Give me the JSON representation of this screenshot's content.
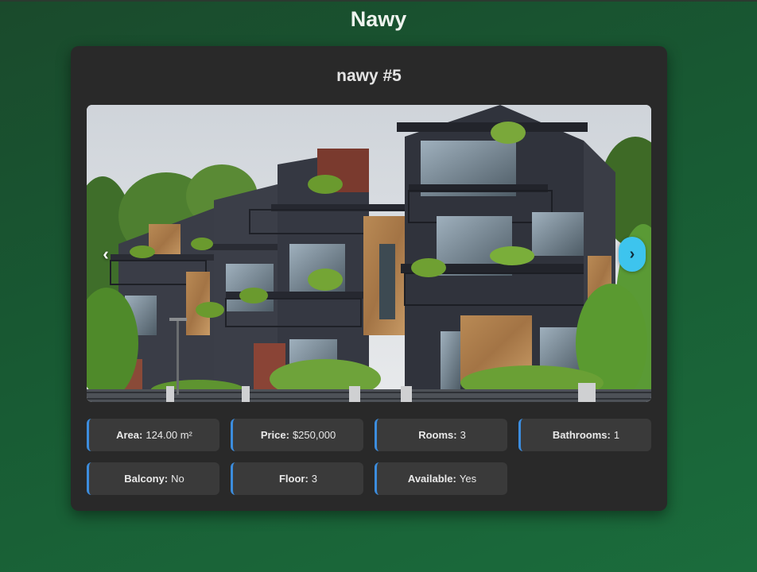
{
  "site": {
    "title": "Nawy"
  },
  "listing": {
    "title": "nawy #5",
    "carousel": {
      "prev_label": "‹",
      "next_label": "›"
    },
    "specs": [
      {
        "label": "Area:",
        "value": "124.00 m²"
      },
      {
        "label": "Price:",
        "value": "$250,000"
      },
      {
        "label": "Rooms:",
        "value": "3"
      },
      {
        "label": "Bathrooms:",
        "value": "1"
      },
      {
        "label": "Balcony:",
        "value": "No"
      },
      {
        "label": "Floor:",
        "value": "3"
      },
      {
        "label": "Available:",
        "value": "Yes"
      }
    ]
  },
  "colors": {
    "background": "#1b5e35",
    "card": "#292929",
    "spec_tile": "#3a3a3a",
    "spec_accent": "#3c8dde",
    "next_button": "#3dc4ee"
  },
  "icons": {
    "prev": "chevron-left-icon",
    "next": "chevron-right-icon"
  }
}
